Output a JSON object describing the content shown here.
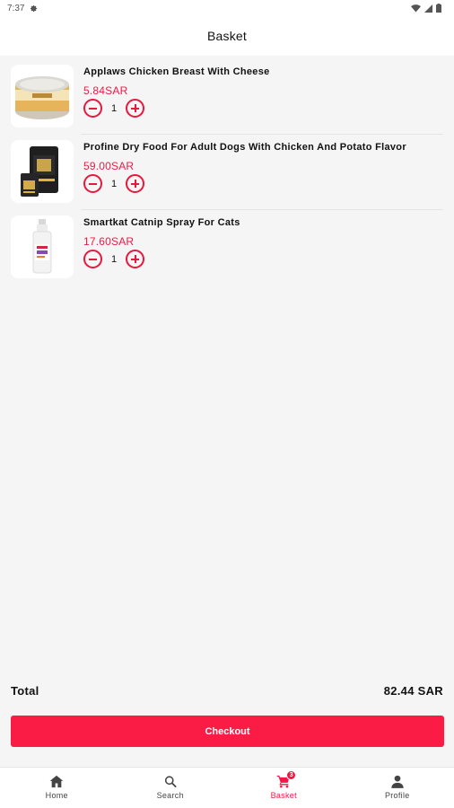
{
  "status_bar": {
    "time": "7:37"
  },
  "header": {
    "title": "Basket"
  },
  "items": [
    {
      "name": "Applaws Chicken Breast With Cheese",
      "price": "5.84SAR",
      "quantity": "1",
      "image": "cat-food-tin"
    },
    {
      "name": "Profine Dry Food For Adult Dogs With Chicken And Potato Flavor",
      "price": "59.00SAR",
      "quantity": "1",
      "image": "dog-food-bag"
    },
    {
      "name": "Smartkat Catnip Spray For Cats",
      "price": "17.60SAR",
      "quantity": "1",
      "image": "spray-bottle"
    }
  ],
  "summary": {
    "total_label": "Total",
    "total_value": "82.44 SAR"
  },
  "checkout": {
    "label": "Checkout"
  },
  "nav": {
    "items": [
      {
        "label": "Home",
        "icon": "home-icon"
      },
      {
        "label": "Search",
        "icon": "search-icon"
      },
      {
        "label": "Basket",
        "icon": "cart-icon",
        "badge": "3",
        "active": true
      },
      {
        "label": "Profile",
        "icon": "person-icon"
      }
    ]
  },
  "colors": {
    "accent": "#fa1c44",
    "price": "#f01946",
    "background": "#f5f5f5"
  }
}
